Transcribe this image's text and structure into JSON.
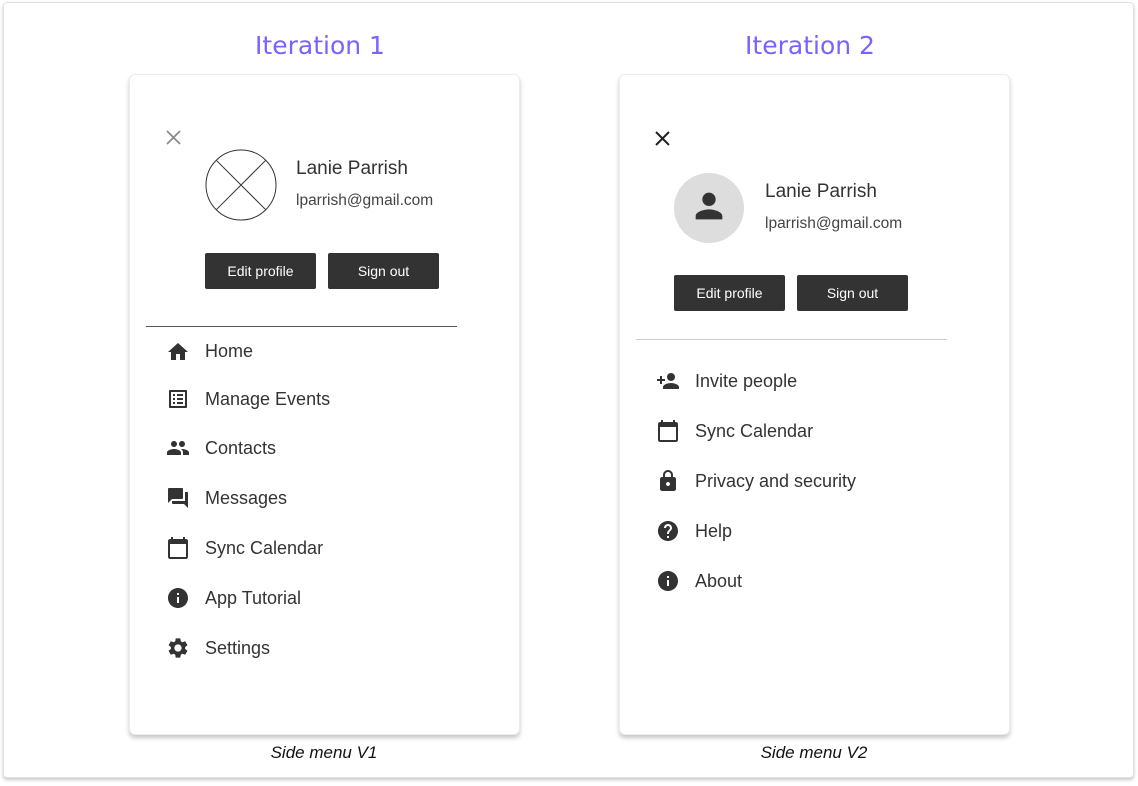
{
  "colors": {
    "heading": "#7b61ff",
    "button_bg": "#333333",
    "icon": "#333333"
  },
  "v1": {
    "heading": "Iteration 1",
    "caption": "Side menu V1",
    "profile": {
      "name": "Lanie Parrish",
      "email": "lparrish@gmail.com",
      "avatar": "image-placeholder"
    },
    "buttons": {
      "edit_profile": "Edit profile",
      "sign_out": "Sign out"
    },
    "menu": [
      {
        "label": "Home",
        "icon": "home-icon"
      },
      {
        "label": "Manage Events",
        "icon": "list-alt-icon"
      },
      {
        "label": "Contacts",
        "icon": "people-icon"
      },
      {
        "label": "Messages",
        "icon": "forum-icon"
      },
      {
        "label": "Sync Calendar",
        "icon": "calendar-icon"
      },
      {
        "label": "App Tutorial",
        "icon": "info-icon"
      },
      {
        "label": "Settings",
        "icon": "gear-icon"
      }
    ]
  },
  "v2": {
    "heading": "Iteration 2",
    "caption": "Side menu V2",
    "profile": {
      "name": "Lanie Parrish",
      "email": "lparrish@gmail.com",
      "avatar": "person-icon"
    },
    "buttons": {
      "edit_profile": "Edit profile",
      "sign_out": "Sign out"
    },
    "menu": [
      {
        "label": "Invite people",
        "icon": "person-add-icon"
      },
      {
        "label": "Sync Calendar",
        "icon": "calendar-icon"
      },
      {
        "label": "Privacy and security",
        "icon": "lock-icon"
      },
      {
        "label": "Help",
        "icon": "help-icon"
      },
      {
        "label": "About",
        "icon": "info-icon"
      }
    ]
  }
}
